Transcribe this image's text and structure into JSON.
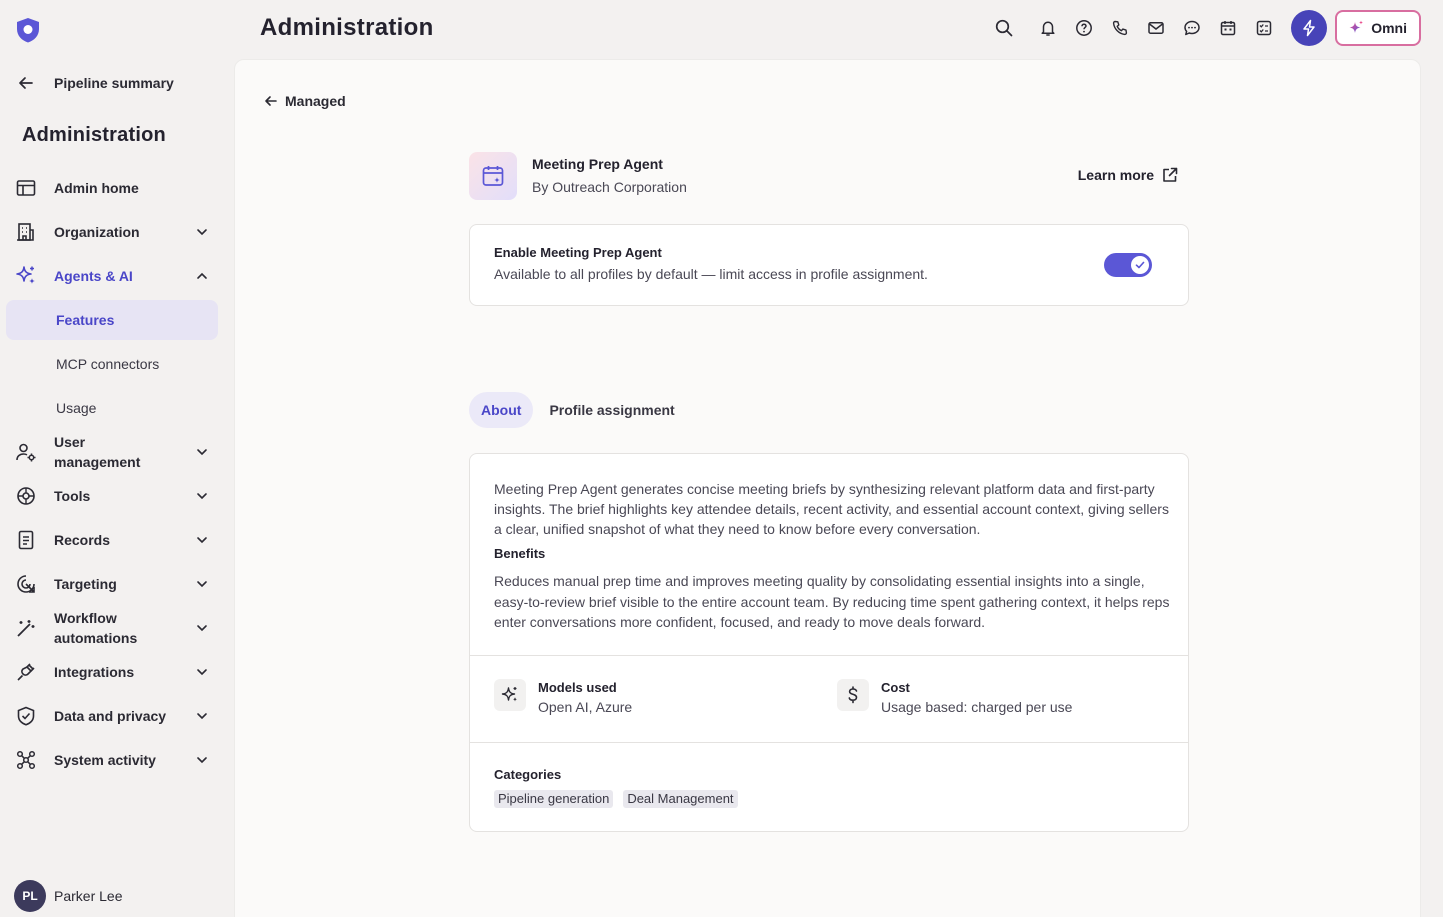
{
  "sidebar": {
    "back_label": "Pipeline summary",
    "title": "Administration",
    "items": [
      {
        "label": "Admin home"
      },
      {
        "label": "Organization"
      },
      {
        "label": "Agents & AI"
      },
      {
        "label": "User management"
      },
      {
        "label": "Tools"
      },
      {
        "label": "Records"
      },
      {
        "label": "Targeting"
      },
      {
        "label": "Workflow automations"
      },
      {
        "label": "Integrations"
      },
      {
        "label": "Data and privacy"
      },
      {
        "label": "System activity"
      }
    ],
    "sub_items": [
      {
        "label": "Features"
      },
      {
        "label": "MCP connectors"
      },
      {
        "label": "Usage"
      }
    ],
    "user": {
      "initials": "PL",
      "name": "Parker Lee"
    }
  },
  "header": {
    "title": "Administration",
    "omni_label": "Omni"
  },
  "main": {
    "back_label": "Managed",
    "agent": {
      "name": "Meeting Prep Agent",
      "by": "By Outreach Corporation",
      "learn_more": "Learn more"
    },
    "enable": {
      "title": "Enable Meeting Prep Agent",
      "description": "Available to all profiles by default — limit access in profile assignment.",
      "enabled": true
    },
    "tabs": [
      {
        "label": "About",
        "active": true
      },
      {
        "label": "Profile assignment",
        "active": false
      }
    ],
    "about": {
      "description": "Meeting Prep Agent generates concise meeting briefs by synthesizing relevant platform data and first-party insights. The brief highlights key attendee details, recent activity, and essential account context, giving sellers a clear, unified snapshot of what they need to know before every conversation.",
      "benefits_heading": "Benefits",
      "benefits": "Reduces manual prep time and improves meeting quality by consolidating essential insights into a single, easy-to-review brief visible to the entire account team. By reducing time spent gathering context, it helps reps enter conversations more confident, focused, and ready to move deals forward.",
      "models_heading": "Models used",
      "models_value": "Open AI, Azure",
      "cost_heading": "Cost",
      "cost_value": "Usage based: charged per use",
      "categories_heading": "Categories",
      "categories": [
        "Pipeline generation",
        "Deal Management"
      ]
    }
  },
  "colors": {
    "accent": "#4a46c8",
    "toggle_on": "#5b57d6",
    "omni_border": "#d86ea0"
  }
}
